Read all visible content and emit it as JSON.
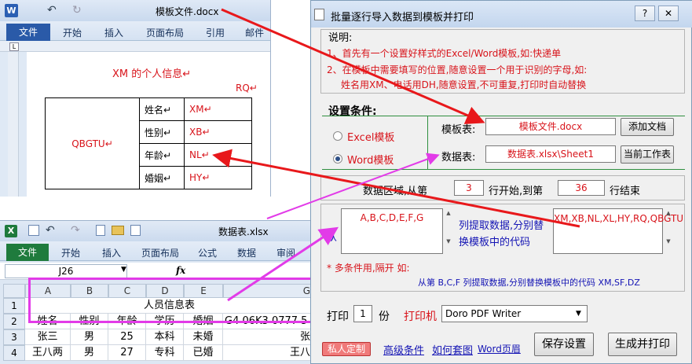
{
  "word": {
    "title": "模板文件.docx",
    "file_tab": "文件",
    "tabs": [
      "开始",
      "插入",
      "页面布局",
      "引用",
      "邮件"
    ],
    "doc_heading": "XM 的个人信息",
    "doc_rq": "RQ",
    "table": {
      "photo": "QBGTU",
      "rows": [
        {
          "label": "姓名",
          "code": "XM"
        },
        {
          "label": "性别",
          "code": "XB"
        },
        {
          "label": "年龄",
          "code": "NL"
        },
        {
          "label": "婚姻",
          "code": "HY"
        }
      ]
    }
  },
  "excel": {
    "title": "数据表.xlsx",
    "file_tab": "文件",
    "tabs": [
      "开始",
      "插入",
      "页面布局",
      "公式",
      "数据",
      "审阅"
    ],
    "name_box": "J26",
    "fx": "fx",
    "col_headers": [
      "A",
      "B",
      "C",
      "D",
      "E",
      "G"
    ],
    "row_headers": [
      "1",
      "2",
      "3",
      "4"
    ],
    "merged_title": "人员信息表",
    "header_row": [
      "姓名",
      "性别",
      "年龄",
      "学历",
      "婚姻",
      "G4 06K3 0777 5"
    ],
    "data_rows": [
      [
        "张三",
        "男",
        "25",
        "本科",
        "未婚",
        "张"
      ],
      [
        "王八两",
        "男",
        "27",
        "专科",
        "已婚",
        "王八"
      ]
    ]
  },
  "dialog": {
    "title": "批量逐行导入数据到模板并打印",
    "help_btn": "?",
    "close_btn": "✕",
    "notes_title": "说明:",
    "note1": "1、首先有一个设置好样式的Excel/Word模板,如:快递单",
    "note2": "2、在模板中需要填写的位置,随意设置一个用于识别的字母,如:",
    "note3": "姓名用XM、电话用DH,随意设置,不可重复,打印时自动替换",
    "settings_title": "设置条件:",
    "radio_excel": "Excel模板",
    "radio_word": "Word模板",
    "template_label": "模板表:",
    "template_value": "模板文件.docx",
    "add_doc_btn": "添加文档",
    "data_label": "数据表:",
    "data_value": "数据表.xlsx\\Sheet1",
    "current_sheet_btn": "当前工作表",
    "range_prefix": "数据区域,从第",
    "start_row": "3",
    "range_mid": "行开始,到第",
    "end_row": "36",
    "range_suffix": "行结束",
    "from_label": "从",
    "columns_value": "A,B,C,D,E,F,G",
    "extract_text": "列提取数据,分别替换模板中的代码",
    "codes_value": "XM,XB,NL,XL,HY,RQ,QBGTU",
    "multi_note": "* 多条件用,隔开 如:",
    "example": "从第 B,C,F 列提取数据,分别替换模板中的代码 XM,SF,DZ",
    "print_label": "打印",
    "copies": "1",
    "copies_unit": "份",
    "printer_label": "打印机",
    "printer_value": "Doro PDF Writer",
    "private_btn": "私人定制",
    "advanced_link": "高级条件",
    "howto_link": "如何套图",
    "wordpage_link": "Word页眉",
    "save_btn": "保存设置",
    "print_btn": "生成并打印"
  },
  "colors": {
    "red_arrow": "#e8181b",
    "magenta_arrow": "#e23be8",
    "code_red": "#d8141b",
    "link_blue": "#1414b4"
  }
}
